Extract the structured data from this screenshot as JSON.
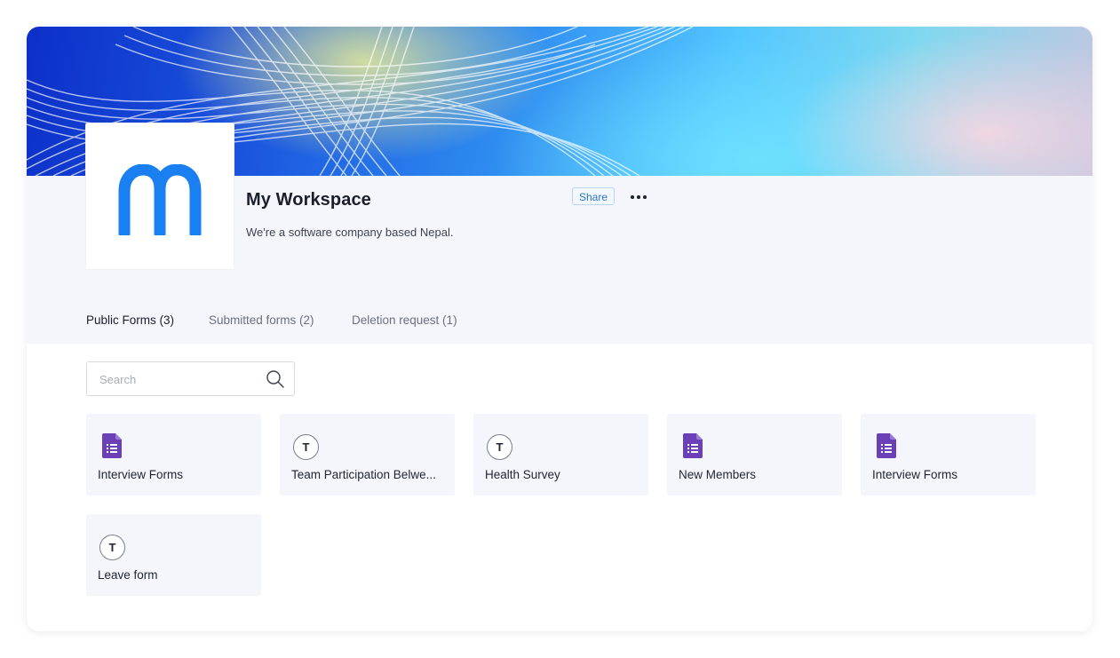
{
  "workspace": {
    "title": "My Workspace",
    "description": "We're a software company based Nepal.",
    "logo_letter": "m",
    "share_label": "Share",
    "more_icon": "more-horizontal-icon"
  },
  "tabs": [
    {
      "label": "Public Forms (3)",
      "active": true
    },
    {
      "label": "Submitted forms (2)",
      "active": false
    },
    {
      "label": "Deletion request (1)",
      "active": false
    }
  ],
  "search": {
    "placeholder": "Search",
    "value": "",
    "icon": "search-icon"
  },
  "forms": [
    {
      "label": "Interview Forms",
      "icon": "google-forms-icon"
    },
    {
      "label": "Team Participation Belwe...",
      "icon": "letter-avatar-icon",
      "initial": "T"
    },
    {
      "label": "Health Survey",
      "icon": "letter-avatar-icon",
      "initial": "T"
    },
    {
      "label": "New Members",
      "icon": "google-forms-icon"
    },
    {
      "label": "Interview Forms",
      "icon": "google-forms-icon"
    },
    {
      "label": "Leave form",
      "icon": "letter-avatar-icon",
      "initial": "T"
    }
  ],
  "colors": {
    "accent": "#1a7ff0",
    "forms_icon": "#6b3fb6",
    "header_bg": "#f5f6fc"
  }
}
